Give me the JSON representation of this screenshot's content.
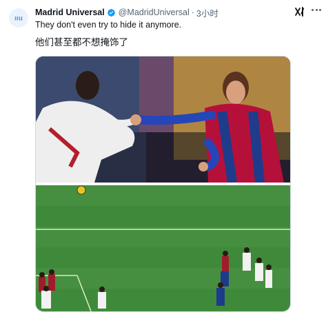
{
  "author": {
    "name": "Madrid Universal",
    "handle": "@MadridUniversal",
    "time": "3小时",
    "avatar_text": "ııu"
  },
  "tweet": {
    "text": "They don't even try to hide it anymore.",
    "translation": "他们甚至都不想掩饰了"
  },
  "icons": {
    "verified": "verified-badge-icon",
    "grok": "grok-icon",
    "more": "more-icon"
  },
  "colors": {
    "verified_blue": "#1d9bf0",
    "handle_gray": "#536471"
  }
}
